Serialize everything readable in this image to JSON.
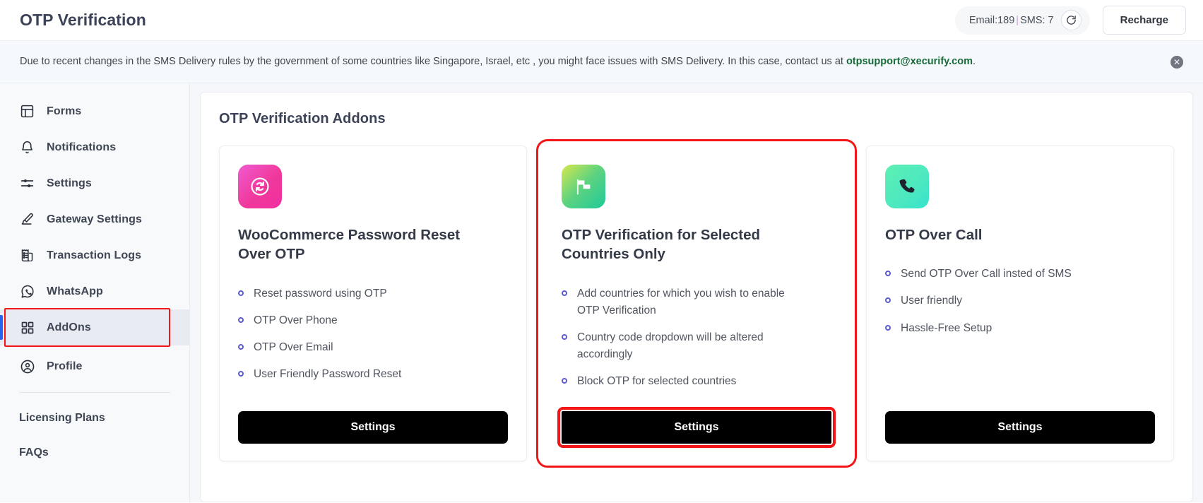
{
  "topbar": {
    "title": "OTP Verification",
    "credits": {
      "email_label": "Email:189",
      "separator": "|",
      "sms_label": "SMS: 7"
    },
    "refresh_icon": "refresh-icon",
    "recharge_label": "Recharge"
  },
  "notice": {
    "text_before": "Due to recent changes in the SMS Delivery rules by the government of some countries like Singapore, Israel, etc , you might face issues with SMS Delivery. In this case, contact us at ",
    "email": "otpsupport@xecurify.com",
    "text_after": ".",
    "close_icon": "close-icon"
  },
  "sidebar": {
    "items": [
      {
        "label": "Forms",
        "icon": "layout-panel-icon",
        "active": false
      },
      {
        "label": "Notifications",
        "icon": "bell-icon",
        "active": false
      },
      {
        "label": "Settings",
        "icon": "sliders-icon",
        "active": false
      },
      {
        "label": "Gateway Settings",
        "icon": "brush-icon",
        "active": false
      },
      {
        "label": "Transaction Logs",
        "icon": "receipt-icon",
        "active": false
      },
      {
        "label": "WhatsApp",
        "icon": "whatsapp-icon",
        "active": false
      },
      {
        "label": "AddOns",
        "icon": "grid-squares-icon",
        "active": true
      },
      {
        "label": "Profile",
        "icon": "user-circle-icon",
        "active": false
      }
    ],
    "footer_items": [
      {
        "label": "Licensing Plans"
      },
      {
        "label": "FAQs"
      }
    ]
  },
  "main": {
    "panel_title": "OTP Verification Addons",
    "cards": [
      {
        "icon": "refresh-password-icon",
        "icon_style": "icon-pink",
        "title": "WooCommerce Password Reset Over OTP",
        "features": [
          "Reset password using OTP",
          "OTP Over Phone",
          "OTP Over Email",
          "User Friendly Password Reset"
        ],
        "button_label": "Settings",
        "highlighted": false,
        "button_highlighted": false
      },
      {
        "icon": "flag-icon",
        "icon_style": "icon-green-flag",
        "title": "OTP Verification for Selected Countries Only",
        "features": [
          "Add countries for which you wish to enable OTP Verification",
          "Country code dropdown will be altered accordingly",
          "Block OTP for selected countries"
        ],
        "button_label": "Settings",
        "highlighted": true,
        "button_highlighted": true
      },
      {
        "icon": "phone-call-icon",
        "icon_style": "icon-teal-call",
        "title": "OTP Over Call",
        "features": [
          "Send OTP Over Call insted of SMS",
          "User friendly",
          "Hassle-Free Setup"
        ],
        "button_label": "Settings",
        "highlighted": false,
        "button_highlighted": false
      }
    ]
  },
  "colors": {
    "highlight_red": "#f31616",
    "accent_blue": "#2a62f0",
    "bullet_purple": "#5b5bd6",
    "link_green": "#176b38",
    "button_black": "#000000"
  }
}
